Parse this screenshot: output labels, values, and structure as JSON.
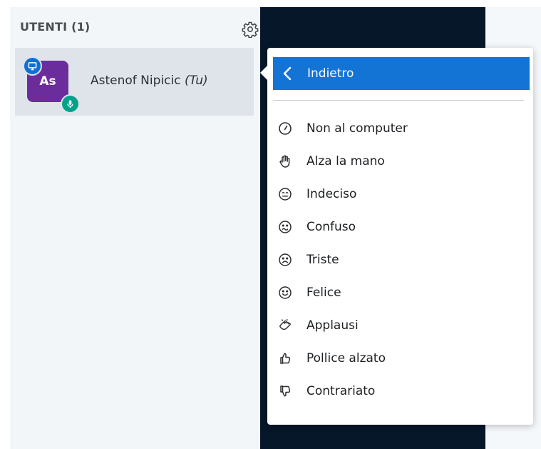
{
  "users_panel": {
    "header": "UTENTI (1)",
    "gear_icon": "gear-icon",
    "user": {
      "initials": "As",
      "name": "Astenof Nipicic",
      "you_tag": "(Tu)",
      "avatar_color": "#6c2d9c",
      "presenter_icon": "presentation-icon",
      "mic_icon": "microphone-icon"
    }
  },
  "status_menu": {
    "back_label": "Indietro",
    "accent": "#1374d6",
    "items": [
      {
        "label": "Non al computer",
        "icon": "clock-icon"
      },
      {
        "label": "Alza la mano",
        "icon": "raise-hand-icon"
      },
      {
        "label": "Indeciso",
        "icon": "neutral-face-icon"
      },
      {
        "label": "Confuso",
        "icon": "confused-face-icon"
      },
      {
        "label": "Triste",
        "icon": "sad-face-icon"
      },
      {
        "label": "Felice",
        "icon": "happy-face-icon"
      },
      {
        "label": "Applausi",
        "icon": "applause-icon"
      },
      {
        "label": "Pollice alzato",
        "icon": "thumbs-up-icon"
      },
      {
        "label": "Contrariato",
        "icon": "thumbs-down-icon"
      }
    ]
  }
}
